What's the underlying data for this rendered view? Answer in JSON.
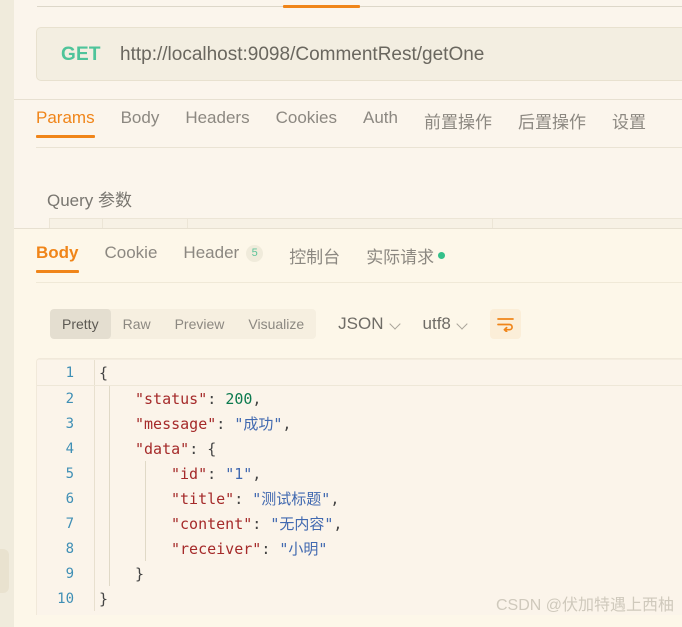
{
  "request": {
    "method": "GET",
    "url": "http://localhost:9098/CommentRest/getOne",
    "tabs": [
      {
        "label": "Params",
        "active": true
      },
      {
        "label": "Body",
        "active": false
      },
      {
        "label": "Headers",
        "active": false
      },
      {
        "label": "Cookies",
        "active": false
      },
      {
        "label": "Auth",
        "active": false
      },
      {
        "label": "前置操作",
        "active": false
      },
      {
        "label": "后置操作",
        "active": false
      },
      {
        "label": "设置",
        "active": false
      }
    ],
    "query_section_title": "Query 参数"
  },
  "response": {
    "tabs": [
      {
        "label": "Body",
        "active": true,
        "badge": null,
        "dot": false
      },
      {
        "label": "Cookie",
        "active": false,
        "badge": null,
        "dot": false
      },
      {
        "label": "Header",
        "active": false,
        "badge": "5",
        "dot": false
      },
      {
        "label": "控制台",
        "active": false,
        "badge": null,
        "dot": false
      },
      {
        "label": "实际请求",
        "active": false,
        "badge": null,
        "dot": true
      }
    ],
    "format_modes": [
      {
        "label": "Pretty",
        "active": true
      },
      {
        "label": "Raw",
        "active": false
      },
      {
        "label": "Preview",
        "active": false
      },
      {
        "label": "Visualize",
        "active": false
      }
    ],
    "language_select": "JSON",
    "encoding_select": "utf8",
    "wrap_icon": "word-wrap-icon"
  },
  "code": {
    "lines": [
      {
        "n": "1",
        "indent": 0,
        "tokens": [
          {
            "t": "{",
            "c": "punct"
          }
        ]
      },
      {
        "n": "2",
        "indent": 1,
        "tokens": [
          {
            "t": "\"status\"",
            "c": "key"
          },
          {
            "t": ": ",
            "c": "punct"
          },
          {
            "t": "200",
            "c": "num"
          },
          {
            "t": ",",
            "c": "punct"
          }
        ]
      },
      {
        "n": "3",
        "indent": 1,
        "tokens": [
          {
            "t": "\"message\"",
            "c": "key"
          },
          {
            "t": ": ",
            "c": "punct"
          },
          {
            "t": "\"成功\"",
            "c": "str"
          },
          {
            "t": ",",
            "c": "punct"
          }
        ]
      },
      {
        "n": "4",
        "indent": 1,
        "tokens": [
          {
            "t": "\"data\"",
            "c": "key"
          },
          {
            "t": ": {",
            "c": "punct"
          }
        ]
      },
      {
        "n": "5",
        "indent": 2,
        "tokens": [
          {
            "t": "\"id\"",
            "c": "key"
          },
          {
            "t": ": ",
            "c": "punct"
          },
          {
            "t": "\"1\"",
            "c": "str"
          },
          {
            "t": ",",
            "c": "punct"
          }
        ]
      },
      {
        "n": "6",
        "indent": 2,
        "tokens": [
          {
            "t": "\"title\"",
            "c": "key"
          },
          {
            "t": ": ",
            "c": "punct"
          },
          {
            "t": "\"测试标题\"",
            "c": "str"
          },
          {
            "t": ",",
            "c": "punct"
          }
        ]
      },
      {
        "n": "7",
        "indent": 2,
        "tokens": [
          {
            "t": "\"content\"",
            "c": "key"
          },
          {
            "t": ": ",
            "c": "punct"
          },
          {
            "t": "\"无内容\"",
            "c": "str"
          },
          {
            "t": ",",
            "c": "punct"
          }
        ]
      },
      {
        "n": "8",
        "indent": 2,
        "tokens": [
          {
            "t": "\"receiver\"",
            "c": "key"
          },
          {
            "t": ": ",
            "c": "punct"
          },
          {
            "t": "\"小明\"",
            "c": "str"
          }
        ]
      },
      {
        "n": "9",
        "indent": 1,
        "tokens": [
          {
            "t": "}",
            "c": "punct"
          }
        ]
      },
      {
        "n": "10",
        "indent": 0,
        "tokens": [
          {
            "t": "}",
            "c": "punct"
          }
        ]
      }
    ],
    "body_json": {
      "status": 200,
      "message": "成功",
      "data": {
        "id": "1",
        "title": "测试标题",
        "content": "无内容",
        "receiver": "小明"
      }
    }
  },
  "watermark": "CSDN @伏加特遇上西柚",
  "colors": {
    "accent": "#f08519",
    "method_get": "#4ec49a",
    "success_dot": "#35c08a",
    "panel_bg": "#fbf5ec",
    "response_bg": "#fdf7e9",
    "line_number": "#3f8fb5",
    "json_key": "#a52a2a",
    "json_string": "#4169b0",
    "json_number": "#0c7a4f"
  }
}
